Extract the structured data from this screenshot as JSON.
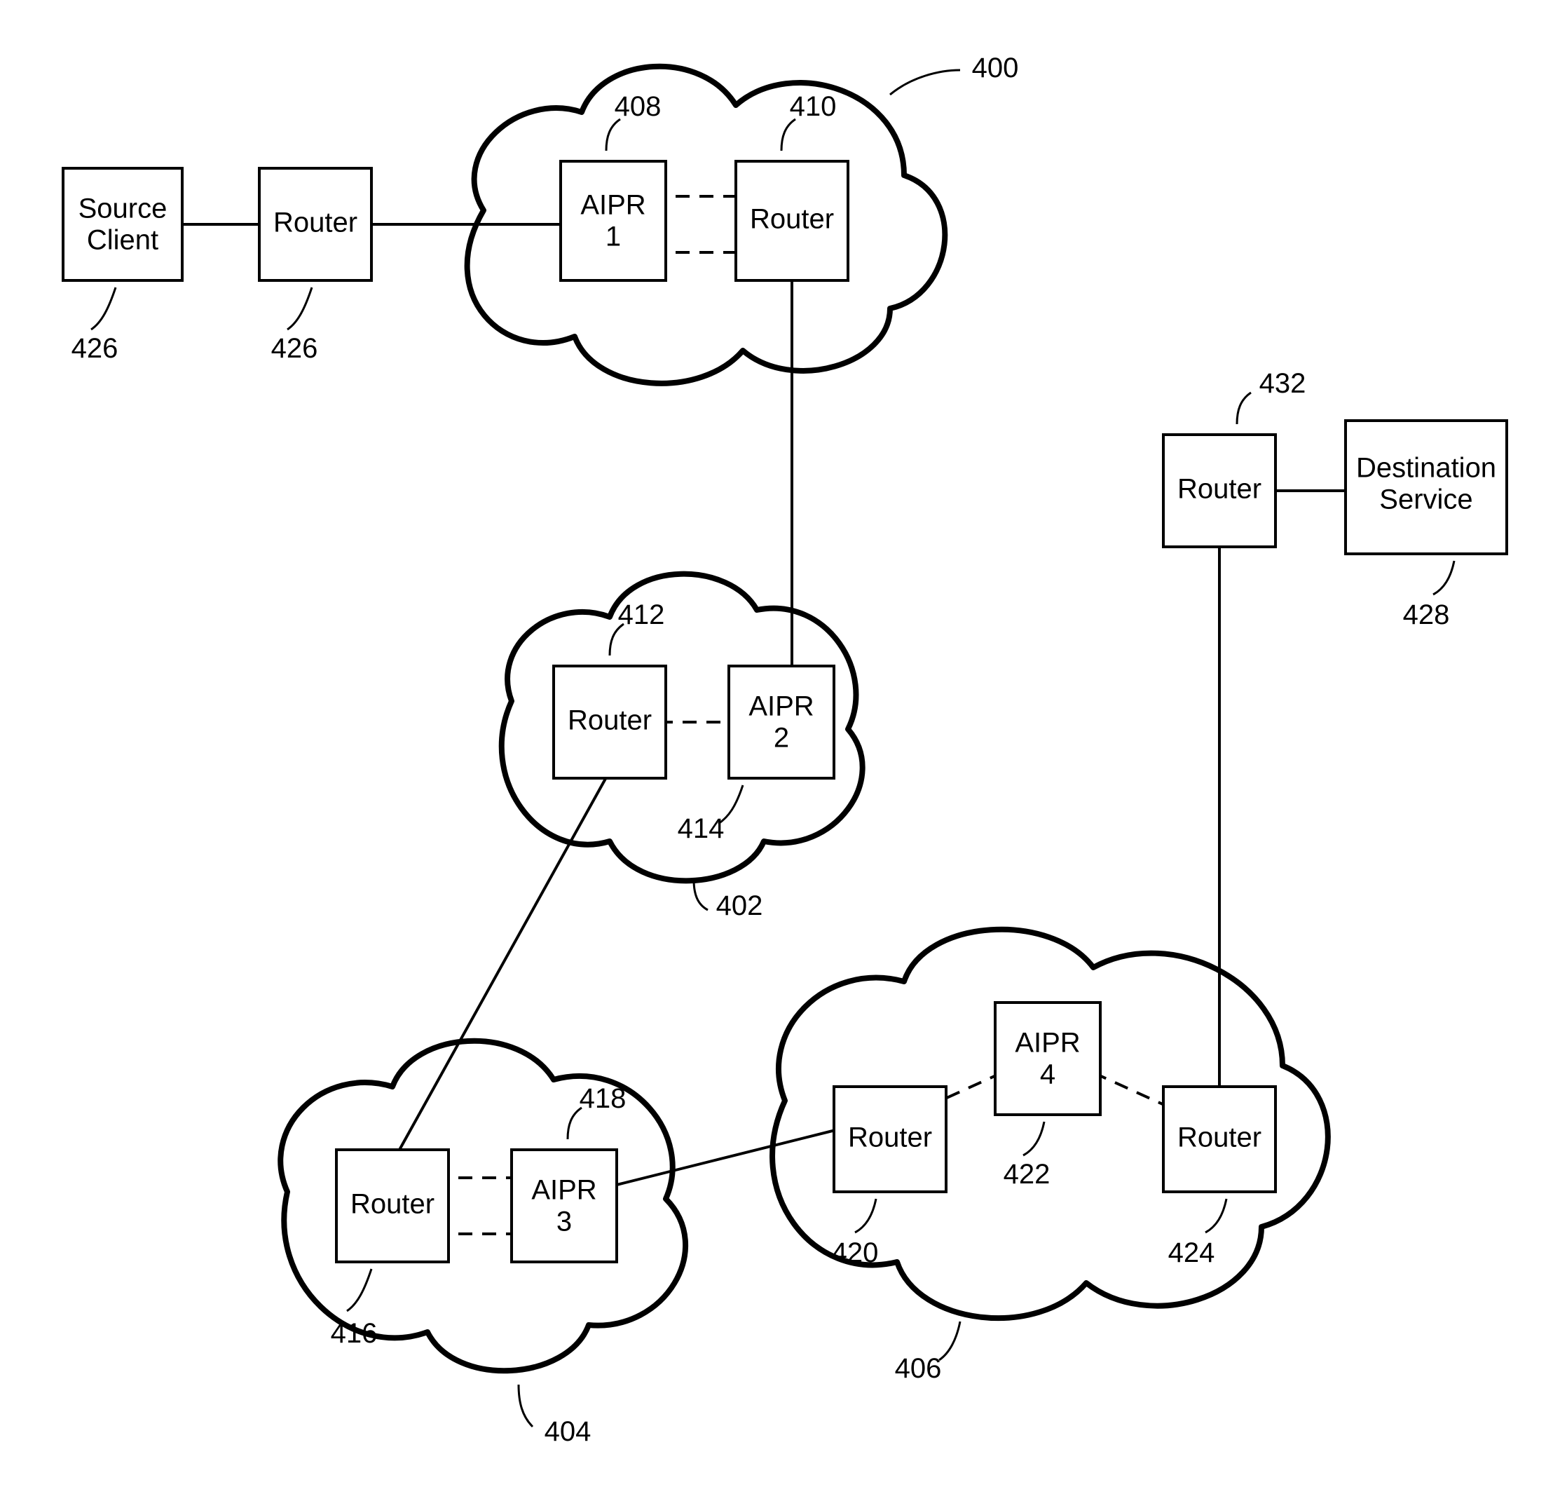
{
  "nodes": {
    "source_client_l1": "Source",
    "source_client_l2": "Client",
    "router_src": "Router",
    "aipr1_l1": "AIPR",
    "aipr1_l2": "1",
    "router_410": "Router",
    "router_412": "Router",
    "aipr2_l1": "AIPR",
    "aipr2_l2": "2",
    "router_416": "Router",
    "aipr3_l1": "AIPR",
    "aipr3_l2": "3",
    "router_420": "Router",
    "aipr4_l1": "AIPR",
    "aipr4_l2": "4",
    "router_424": "Router",
    "router_432": "Router",
    "dest_l1": "Destination",
    "dest_l2": "Service"
  },
  "refs": {
    "r400": "400",
    "r402": "402",
    "r404": "404",
    "r406": "406",
    "r408": "408",
    "r410": "410",
    "r412": "412",
    "r414": "414",
    "r416": "416",
    "r418": "418",
    "r420": "420",
    "r422": "422",
    "r424": "424",
    "r426a": "426",
    "r426b": "426",
    "r428": "428",
    "r432": "432"
  }
}
